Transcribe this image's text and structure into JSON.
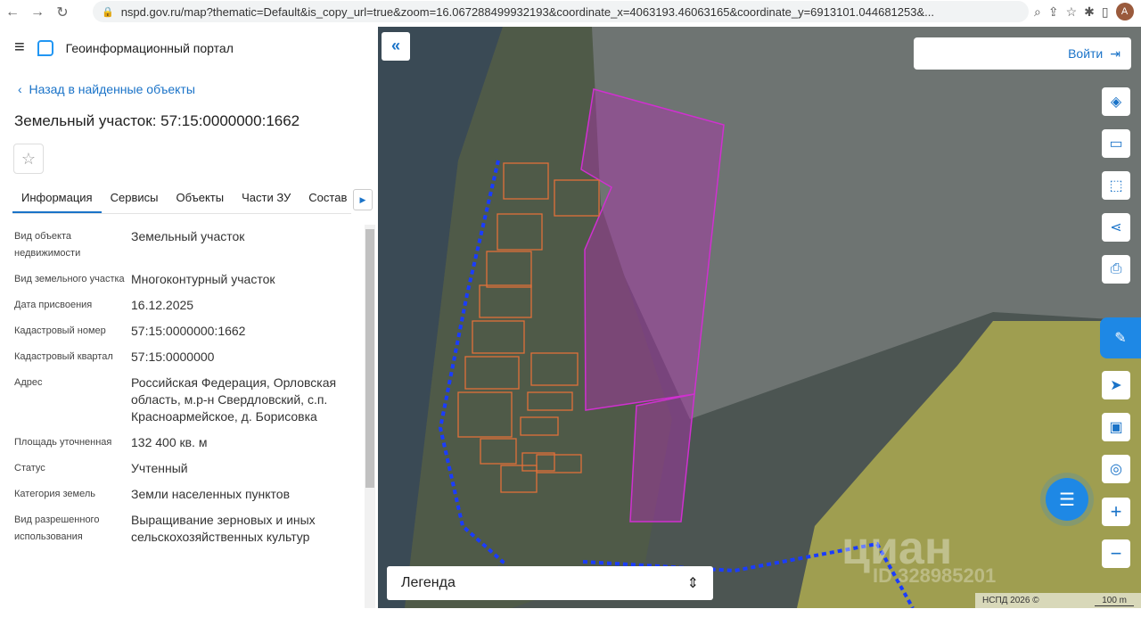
{
  "browser": {
    "url": "nspd.gov.ru/map?thematic=Default&is_copy_url=true&zoom=16.067288499932193&coordinate_x=4063193.46063165&coordinate_y=6913101.044681253&...",
    "avatar": "A"
  },
  "header": {
    "app_title": "Геоинформационный портал"
  },
  "panel": {
    "back_link": "Назад в найденные объекты",
    "title": "Земельный участок: 57:15:0000000:1662",
    "tabs": [
      {
        "label": "Информация",
        "active": true
      },
      {
        "label": "Сервисы"
      },
      {
        "label": "Объекты"
      },
      {
        "label": "Части ЗУ"
      },
      {
        "label": "Состав"
      }
    ],
    "rows": [
      {
        "k": "Вид объекта недвижимости",
        "v": "Земельный участок"
      },
      {
        "k": "Вид земельного участка",
        "v": "Многоконтурный участок"
      },
      {
        "k": "Дата присвоения",
        "v": "16.12.2025"
      },
      {
        "k": "Кадастровый номер",
        "v": "57:15:0000000:1662"
      },
      {
        "k": "Кадастровый квартал",
        "v": "57:15:0000000"
      },
      {
        "k": "Адрес",
        "v": "Российская Федерация, Орловская область, м.р-н Свердловский, с.п. Красноармейское, д. Борисовка"
      },
      {
        "k": "Площадь уточненная",
        "v": "132 400 кв. м"
      },
      {
        "k": "Статус",
        "v": "Учтенный"
      },
      {
        "k": "Категория земель",
        "v": "Земли населенных пунктов"
      },
      {
        "k": "Вид разрешенного использования",
        "v": "Выращивание зерновых и иных сельскохозяйственных культур"
      }
    ]
  },
  "map": {
    "login_label": "Войти",
    "legend_label": "Легенда",
    "attribution": "НСПД 2026 ©",
    "scale_label": "100 m",
    "watermark": "циан",
    "watermark_id": "ID 328985201",
    "colors": {
      "selected_parcel": "#c020c0",
      "parcels": "#e0703a",
      "zone": "#c8c050",
      "boundary": "#1a3cff",
      "accent": "#1a73c8"
    }
  }
}
